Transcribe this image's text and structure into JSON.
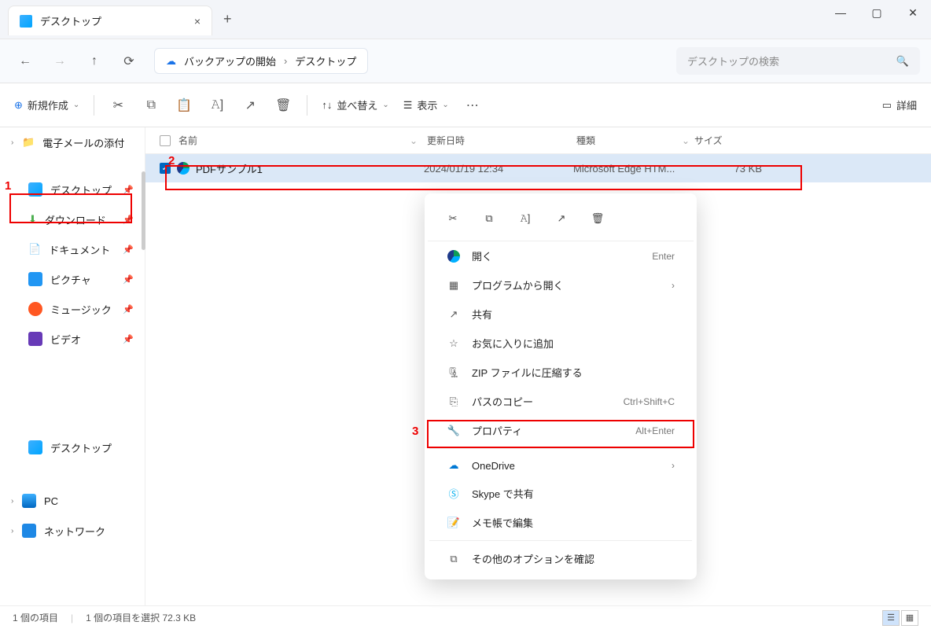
{
  "window": {
    "title": "デスクトップ"
  },
  "nav": {
    "backup_label": "バックアップの開始",
    "location": "デスクトップ"
  },
  "search": {
    "placeholder": "デスクトップの検索"
  },
  "toolbar": {
    "new": "新規作成",
    "sort": "並べ替え",
    "view": "表示",
    "details": "詳細"
  },
  "columns": {
    "name": "名前",
    "date": "更新日時",
    "type": "種類",
    "size": "サイズ"
  },
  "sidebar": {
    "email": "電子メールの添付",
    "desktop": "デスクトップ",
    "downloads": "ダウンロード",
    "documents": "ドキュメント",
    "pictures": "ピクチャ",
    "music": "ミュージック",
    "videos": "ビデオ",
    "desktop2": "デスクトップ",
    "pc": "PC",
    "network": "ネットワーク"
  },
  "file": {
    "name": "PDFサンプル1",
    "date": "2024/01/19 12:34",
    "type": "Microsoft Edge HTM...",
    "size": "73 KB"
  },
  "ctx": {
    "open": "開く",
    "open_sc": "Enter",
    "openwith": "プログラムから開く",
    "share": "共有",
    "fav": "お気に入りに追加",
    "zip": "ZIP ファイルに圧縮する",
    "copypath": "パスのコピー",
    "copypath_sc": "Ctrl+Shift+C",
    "props": "プロパティ",
    "props_sc": "Alt+Enter",
    "onedrive": "OneDrive",
    "skype": "Skype で共有",
    "notepad": "メモ帳で編集",
    "more": "その他のオプションを確認"
  },
  "status": {
    "count": "1 個の項目",
    "selected": "1 個の項目を選択 72.3 KB"
  },
  "annotations": {
    "n1": "1",
    "n2": "2",
    "n3": "3"
  }
}
